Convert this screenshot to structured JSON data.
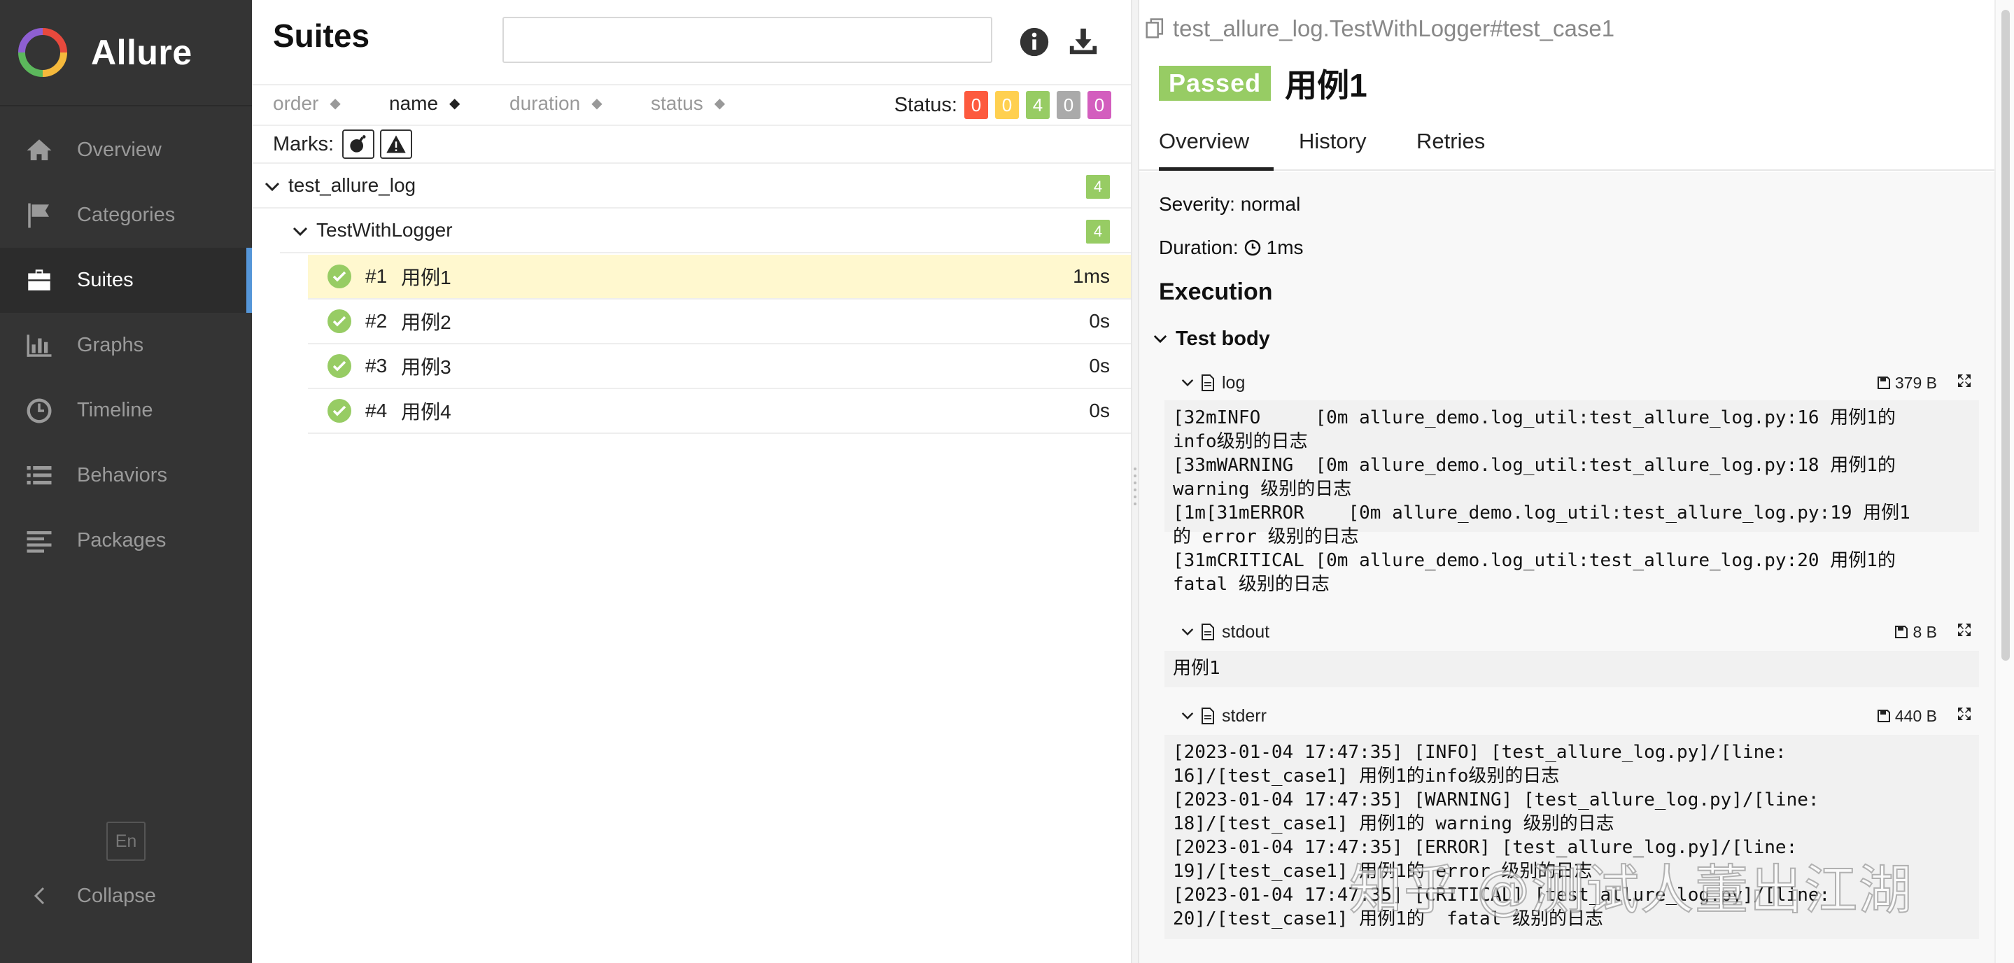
{
  "app": {
    "name": "Allure"
  },
  "sidebar": {
    "items": [
      {
        "label": "Overview",
        "icon": "home-icon"
      },
      {
        "label": "Categories",
        "icon": "flag-icon"
      },
      {
        "label": "Suites",
        "icon": "briefcase-icon",
        "active": true
      },
      {
        "label": "Graphs",
        "icon": "bar-chart-icon"
      },
      {
        "label": "Timeline",
        "icon": "clock-icon"
      },
      {
        "label": "Behaviors",
        "icon": "list-icon"
      },
      {
        "label": "Packages",
        "icon": "align-left-icon"
      }
    ],
    "lang": "En",
    "collapse": "Collapse"
  },
  "suites": {
    "title": "Suites",
    "search_placeholder": "",
    "sort": {
      "order": "order",
      "name": "name",
      "duration": "duration",
      "status": "status"
    },
    "status_label": "Status:",
    "status_counts": [
      {
        "value": "0",
        "color": "#fd5a3e"
      },
      {
        "value": "0",
        "color": "#ffd050"
      },
      {
        "value": "4",
        "color": "#97cc64"
      },
      {
        "value": "0",
        "color": "#aaaaaa"
      },
      {
        "value": "0",
        "color": "#d35ebe"
      }
    ],
    "marks_label": "Marks:",
    "tree": {
      "suite": {
        "name": "test_allure_log",
        "count": "4"
      },
      "class": {
        "name": "TestWithLogger",
        "count": "4"
      },
      "cases": [
        {
          "num": "#1",
          "name": "用例1",
          "time": "1ms"
        },
        {
          "num": "#2",
          "name": "用例2",
          "time": "0s"
        },
        {
          "num": "#3",
          "name": "用例3",
          "time": "0s"
        },
        {
          "num": "#4",
          "name": "用例4",
          "time": "0s"
        }
      ]
    }
  },
  "detail": {
    "path": "test_allure_log.TestWithLogger#test_case1",
    "status": "Passed",
    "name": "用例1",
    "tabs": [
      "Overview",
      "History",
      "Retries"
    ],
    "severity": "Severity: normal",
    "duration_label": "Duration:",
    "duration": "1ms",
    "execution": "Execution",
    "test_body": "Test body",
    "attachments": [
      {
        "name": "log",
        "size": "379 B",
        "content": "[32mINFO     [0m allure_demo.log_util:test_allure_log.py:16 用例1的\ninfo级别的日志\n[33mWARNING  [0m allure_demo.log_util:test_allure_log.py:18 用例1的\nwarning 级别的日志\n[1m[31mERROR    [0m allure_demo.log_util:test_allure_log.py:19 用例1\n的 error 级别的日志\n[31mCRITICAL [0m allure_demo.log_util:test_allure_log.py:20 用例1的\nfatal 级别的日志"
      },
      {
        "name": "stdout",
        "size": "8 B",
        "content": "用例1"
      },
      {
        "name": "stderr",
        "size": "440 B",
        "content": "[2023-01-04 17:47:35] [INFO] [test_allure_log.py]/[line:\n16]/[test_case1] 用例1的info级别的日志\n[2023-01-04 17:47:35] [WARNING] [test_allure_log.py]/[line:\n18]/[test_case1] 用例1的 warning 级别的日志\n[2023-01-04 17:47:35] [ERROR] [test_allure_log.py]/[line:\n19]/[test_case1] 用例1的 error 级别的日志\n[2023-01-04 17:47:35] [CRITICAL] [test_allure_log.py]/[line:\n20]/[test_case1] 用例1的  fatal 级别的日志"
      }
    ]
  },
  "watermark": "知乎 @测试人董出江湖"
}
